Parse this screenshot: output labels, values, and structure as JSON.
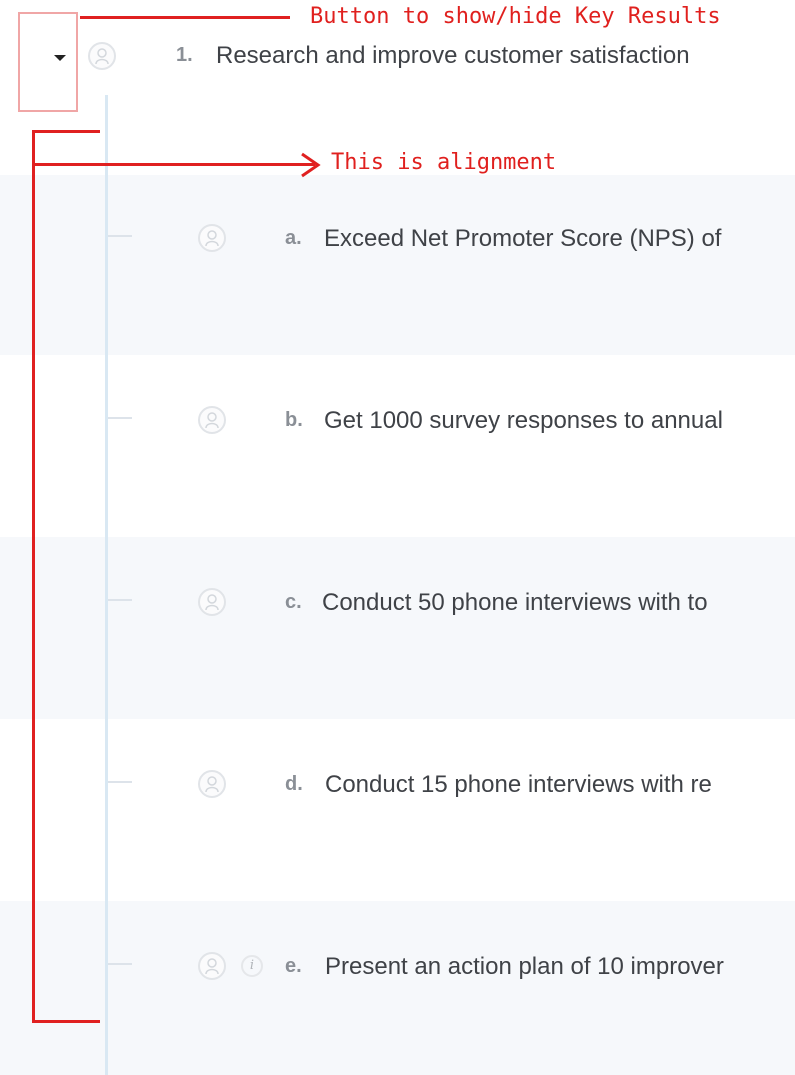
{
  "objective": {
    "number": "1.",
    "title": "Research and improve customer satisfaction"
  },
  "key_results": [
    {
      "letter": "a.",
      "text": "Exceed Net Promoter Score (NPS) of",
      "has_info": false
    },
    {
      "letter": "b.",
      "text": "Get 1000 survey responses to annual",
      "has_info": false
    },
    {
      "letter": "c.",
      "text": "Conduct 50 phone interviews with to",
      "has_info": false
    },
    {
      "letter": "d.",
      "text": "Conduct 15 phone interviews with re",
      "has_info": false
    },
    {
      "letter": "e.",
      "text": "Present an action plan of 10 improver",
      "has_info": true
    }
  ],
  "annotations": {
    "toggle_note": "Button to show/hide Key Results",
    "alignment_note": "This is alignment"
  },
  "icons": {
    "toggle": "caret-down-icon",
    "owner": "user-avatar-icon",
    "info": "info-icon",
    "info_glyph": "i"
  },
  "colors": {
    "annotation": "#e02020",
    "alignment_line": "#d9e8f3",
    "row_shade": "#f6f8fb"
  }
}
